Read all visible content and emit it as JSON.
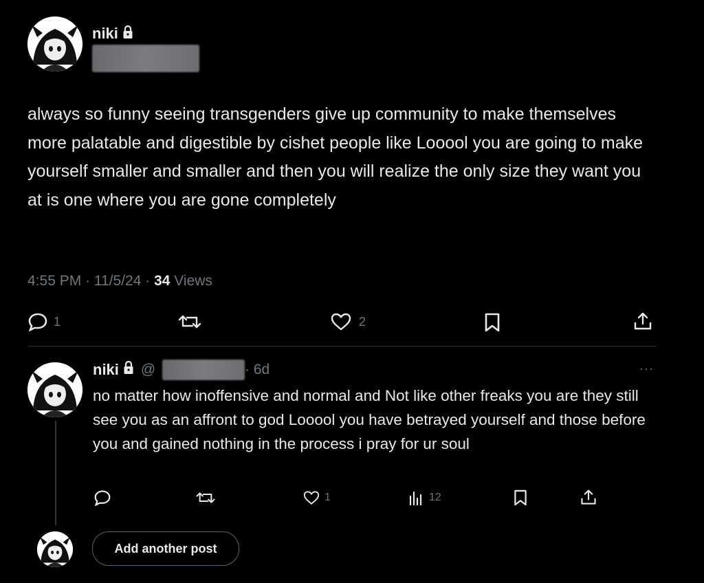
{
  "main_post": {
    "display_name": "niki",
    "text": "always so funny seeing transgenders give up community to make themselves more palatable and digestible by cishet people like Looool you are going to make yourself smaller and smaller and then you will realize the only size they want you at is one where you are gone completely",
    "time": "4:55 PM",
    "date": "11/5/24",
    "views_count": "34",
    "views_label": "Views",
    "replies": "1",
    "likes": "2",
    "icons": [
      "reply-icon",
      "retweet-icon",
      "like-icon",
      "bookmark-icon",
      "share-icon"
    ]
  },
  "reply_post": {
    "display_name": "niki",
    "at_symbol": "@",
    "age": "· 6d",
    "more": "···",
    "text": "no matter how inoffensive and normal and Not like other freaks you are they still see you as an affront to god Looool you have betrayed yourself and those before you and gained nothing in the process i pray for ur soul",
    "likes": "1",
    "views": "12"
  },
  "composer": {
    "add_label": "Add another post"
  },
  "colors": {
    "background": "#000000",
    "text": "#e7e9ea",
    "muted": "#71767b",
    "divider": "#2f3336"
  }
}
